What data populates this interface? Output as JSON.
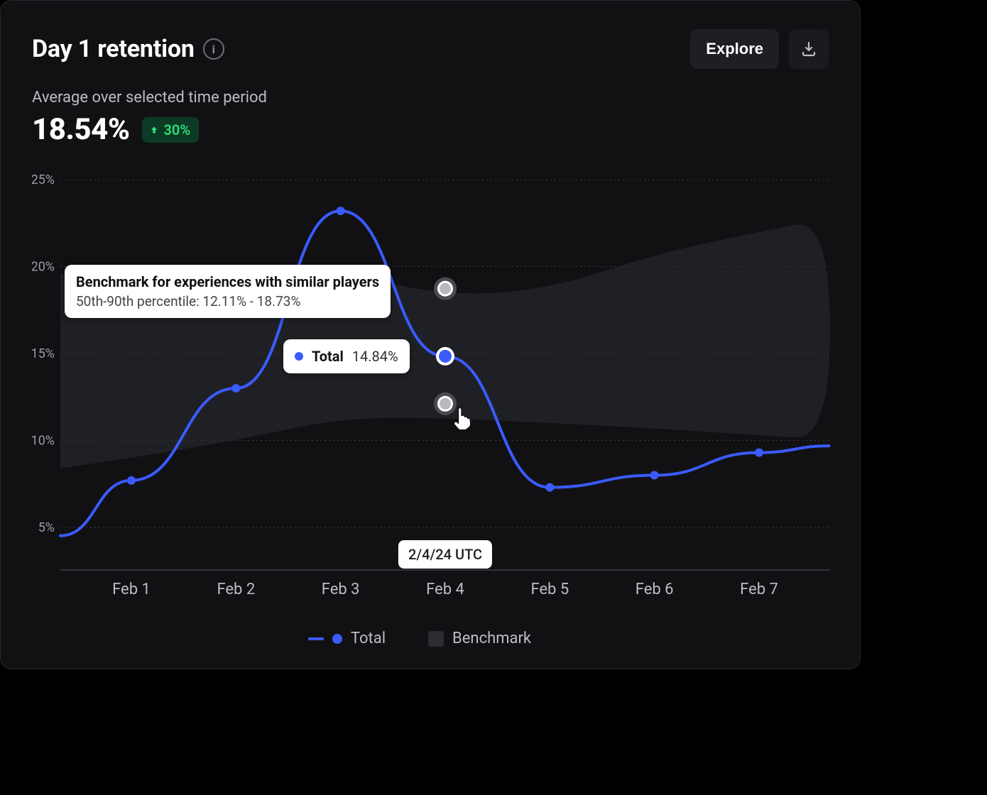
{
  "header": {
    "title": "Day 1 retention",
    "explore_label": "Explore"
  },
  "summary": {
    "subtitle": "Average over selected time period",
    "value": "18.54%",
    "delta": "30%"
  },
  "tooltip": {
    "benchmark_title": "Benchmark for experiences with similar players",
    "benchmark_sub": "50th-90th percentile: 12.11% - 18.73%",
    "series_label": "Total",
    "series_value": "14.84%",
    "date_label": "2/4/24 UTC"
  },
  "legend": {
    "total": "Total",
    "benchmark": "Benchmark"
  },
  "chart_data": {
    "type": "line",
    "title": "Day 1 retention",
    "xlabel": "",
    "ylabel": "",
    "ylim": [
      5,
      25
    ],
    "y_ticks": [
      "5%",
      "10%",
      "15%",
      "20%",
      "25%"
    ],
    "categories": [
      "Feb 1",
      "Feb 2",
      "Feb 3",
      "Feb 4",
      "Feb 5",
      "Feb 6",
      "Feb 7"
    ],
    "series": [
      {
        "name": "Total",
        "values": [
          7.7,
          13.0,
          23.2,
          14.84,
          7.3,
          8.0,
          9.3
        ]
      }
    ],
    "benchmark_band": {
      "name": "Benchmark (50th–90th percentile)",
      "lower": [
        9.0,
        10.0,
        11.3,
        11.3,
        11.0,
        10.7,
        10.3
      ],
      "upper": [
        19.8,
        20.2,
        19.7,
        18.3,
        18.7,
        20.7,
        22.0
      ]
    },
    "highlight_index": 3,
    "highlight": {
      "date": "2/4/24 UTC",
      "total": 14.84,
      "benchmark_lower": 12.11,
      "benchmark_upper": 18.73
    }
  }
}
